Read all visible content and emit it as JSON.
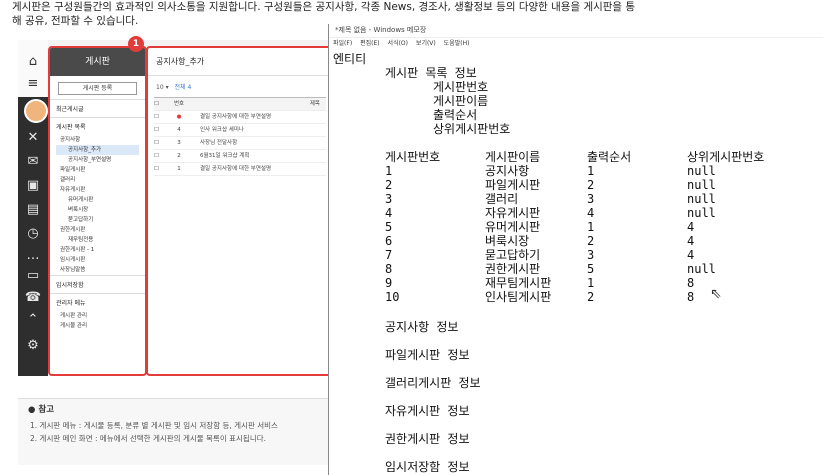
{
  "intro": {
    "line1": "게시판은 구성원들간의 효과적인 의사소통을 지원합니다. 구성원들은 공지사항, 각종 News, 경조사, 생활정보 등의 다양한 내용을 게시판을 통",
    "line2": "해 공유, 전파할 수 있습니다."
  },
  "app": {
    "panel1": {
      "header": "게시판",
      "badge": "1",
      "register_button": "게시판 등록",
      "section_recent": "최근게시글",
      "section_list": "게시판 목록",
      "tree": [
        {
          "label": "공지사항",
          "depth": 1
        },
        {
          "label": "공지사항_추가",
          "depth": 2,
          "selected": true
        },
        {
          "label": "공지사항_부연설명",
          "depth": 2
        },
        {
          "label": "파일게시판",
          "depth": 1
        },
        {
          "label": "갤러리",
          "depth": 1
        },
        {
          "label": "자유게시판",
          "depth": 1
        },
        {
          "label": "유머게시판",
          "depth": 2
        },
        {
          "label": "벼룩시장",
          "depth": 2
        },
        {
          "label": "묻고답하기",
          "depth": 2
        },
        {
          "label": "권한게시판",
          "depth": 1
        },
        {
          "label": "재무팀전용",
          "depth": 2
        },
        {
          "label": "권한게시판 - 1",
          "depth": 1
        },
        {
          "label": "임시게시판",
          "depth": 1
        },
        {
          "label": "사장님말씀",
          "depth": 1
        }
      ],
      "section_temp": "임시저장함",
      "section_admin": "관리자 메뉴",
      "admin_items": [
        "게시판 관리",
        "게시물 관리"
      ]
    },
    "panel2": {
      "title": "공지사항_추가",
      "page_size": "10",
      "total": "전체 4",
      "headers": {
        "num": "번호",
        "title": "제목"
      },
      "rows": [
        {
          "num": "",
          "title": "결일 공지사항에 대한 부연설명"
        },
        {
          "num": "4",
          "title": "인사 워크샵 세미나"
        },
        {
          "num": "3",
          "title": "사장님 전달사항"
        },
        {
          "num": "2",
          "title": "6월31일 워크샵 계획"
        },
        {
          "num": "1",
          "title": "결일 공지사항에 대한 부연설명"
        }
      ]
    },
    "icons": [
      "home-icon",
      "menu-icon",
      "tools-icon",
      "mail-icon",
      "briefcase-icon",
      "clipboard-icon",
      "clock-icon",
      "chat-icon",
      "car-icon",
      "phone-icon",
      "settings-icon"
    ]
  },
  "note": {
    "head": "참고",
    "line1": "1. 게시판 메뉴 : 게시물 등록, 분류 별 게시판 및 임시 저장함 등, 게시판 서비스",
    "line2": "2. 게시판 메인 화면 : 메뉴에서 선택한 게시판의 게시물 목록이 표시됩니다."
  },
  "notepad": {
    "title": "*제목 없음 - Windows 메모장",
    "menu": [
      "파일(F)",
      "편집(E)",
      "서식(O)",
      "보기(V)",
      "도움말(H)"
    ],
    "entity_label": "엔티티",
    "info_title": "게시판 목록 정보",
    "info_fields": [
      "게시판번호",
      "게시판이름",
      "출력순서",
      "상위게시판번호"
    ],
    "table_headers": [
      "게시판번호",
      "게시판이름",
      "출력순서",
      "상위게시판번호"
    ],
    "table_rows": [
      [
        "1",
        "공지사항",
        "1",
        "null"
      ],
      [
        "2",
        "파일게시판",
        "2",
        "null"
      ],
      [
        "3",
        "갤러리",
        "3",
        "null"
      ],
      [
        "4",
        "자유게시판",
        "4",
        "null"
      ],
      [
        "5",
        "유머게시판",
        "1",
        "4"
      ],
      [
        "6",
        "벼룩시장",
        "2",
        "4"
      ],
      [
        "7",
        "묻고답하기",
        "3",
        "4"
      ],
      [
        "8",
        "권한게시판",
        "5",
        "null"
      ],
      [
        "9",
        "재무팀게시판",
        "1",
        "8"
      ],
      [
        "10",
        "인사팀게시판",
        "2",
        "8"
      ]
    ],
    "sections": [
      "공지사항 정보",
      "파일게시판 정보",
      "갤러리게시판 정보",
      "자유게시판 정보",
      "권한게시판 정보",
      "임시저장함 정보"
    ]
  }
}
